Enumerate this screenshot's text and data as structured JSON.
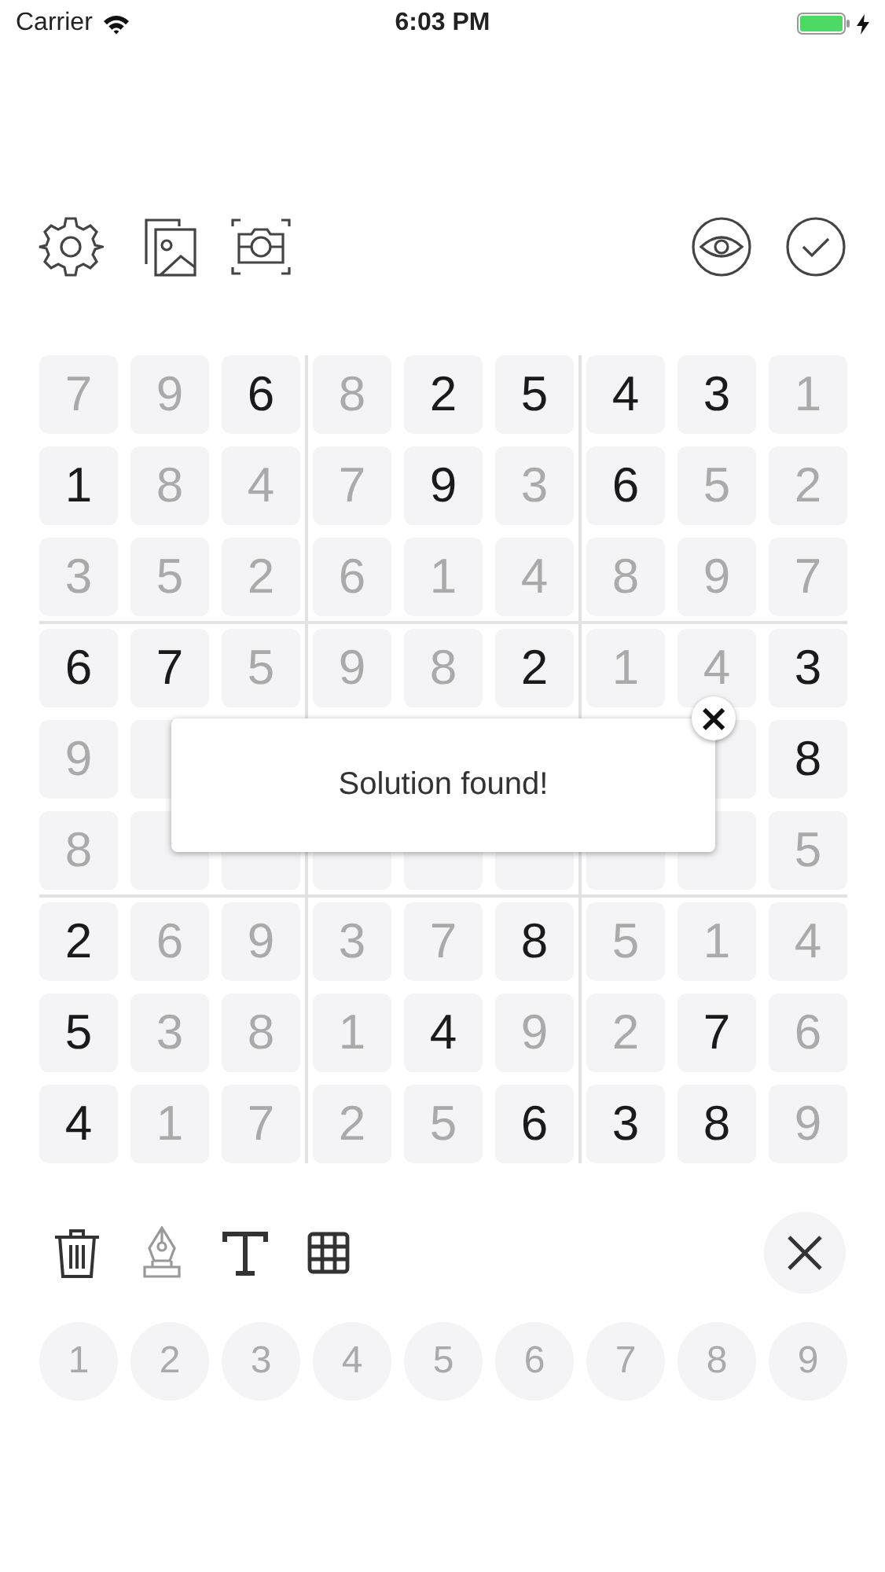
{
  "status_bar": {
    "carrier": "Carrier",
    "time": "6:03 PM",
    "charging": true
  },
  "board": {
    "rows": [
      [
        {
          "value": "7",
          "given": false
        },
        {
          "value": "9",
          "given": false
        },
        {
          "value": "6",
          "given": true
        },
        {
          "value": "8",
          "given": false
        },
        {
          "value": "2",
          "given": true
        },
        {
          "value": "5",
          "given": true
        },
        {
          "value": "4",
          "given": true
        },
        {
          "value": "3",
          "given": true
        },
        {
          "value": "1",
          "given": false
        }
      ],
      [
        {
          "value": "1",
          "given": true
        },
        {
          "value": "8",
          "given": false
        },
        {
          "value": "4",
          "given": false
        },
        {
          "value": "7",
          "given": false
        },
        {
          "value": "9",
          "given": true
        },
        {
          "value": "3",
          "given": false
        },
        {
          "value": "6",
          "given": true
        },
        {
          "value": "5",
          "given": false
        },
        {
          "value": "2",
          "given": false
        }
      ],
      [
        {
          "value": "3",
          "given": false
        },
        {
          "value": "5",
          "given": false
        },
        {
          "value": "2",
          "given": false
        },
        {
          "value": "6",
          "given": false
        },
        {
          "value": "1",
          "given": false
        },
        {
          "value": "4",
          "given": false
        },
        {
          "value": "8",
          "given": false
        },
        {
          "value": "9",
          "given": false
        },
        {
          "value": "7",
          "given": false
        }
      ],
      [
        {
          "value": "6",
          "given": true
        },
        {
          "value": "7",
          "given": true
        },
        {
          "value": "5",
          "given": false
        },
        {
          "value": "9",
          "given": false
        },
        {
          "value": "8",
          "given": false
        },
        {
          "value": "2",
          "given": true
        },
        {
          "value": "1",
          "given": false
        },
        {
          "value": "4",
          "given": false
        },
        {
          "value": "3",
          "given": true
        }
      ],
      [
        {
          "value": "9",
          "given": false
        },
        {},
        {},
        {},
        {},
        {},
        {},
        {},
        {
          "value": "8",
          "given": true
        }
      ],
      [
        {
          "value": "8",
          "given": false
        },
        {},
        {},
        {},
        {},
        {},
        {},
        {},
        {
          "value": "5",
          "given": false
        }
      ],
      [
        {
          "value": "2",
          "given": true
        },
        {
          "value": "6",
          "given": false
        },
        {
          "value": "9",
          "given": false
        },
        {
          "value": "3",
          "given": false
        },
        {
          "value": "7",
          "given": false
        },
        {
          "value": "8",
          "given": true
        },
        {
          "value": "5",
          "given": false
        },
        {
          "value": "1",
          "given": false
        },
        {
          "value": "4",
          "given": false
        }
      ],
      [
        {
          "value": "5",
          "given": true
        },
        {
          "value": "3",
          "given": false
        },
        {
          "value": "8",
          "given": false
        },
        {
          "value": "1",
          "given": false
        },
        {
          "value": "4",
          "given": true
        },
        {
          "value": "9",
          "given": false
        },
        {
          "value": "2",
          "given": false
        },
        {
          "value": "7",
          "given": true
        },
        {
          "value": "6",
          "given": false
        }
      ],
      [
        {
          "value": "4",
          "given": true
        },
        {
          "value": "1",
          "given": false
        },
        {
          "value": "7",
          "given": false
        },
        {
          "value": "2",
          "given": false
        },
        {
          "value": "5",
          "given": false
        },
        {
          "value": "6",
          "given": true
        },
        {
          "value": "3",
          "given": true
        },
        {
          "value": "8",
          "given": true
        },
        {
          "value": "9",
          "given": false
        }
      ]
    ]
  },
  "alert": {
    "message": "Solution found!",
    "close": "×"
  },
  "edit_tools": [
    {
      "kind": "trash",
      "disabled": false
    },
    {
      "kind": "pen",
      "disabled": true
    },
    {
      "kind": "text",
      "disabled": false
    },
    {
      "kind": "grid",
      "disabled": false
    }
  ],
  "number_pad": [
    {
      "label": "1",
      "disabled": true
    },
    {
      "label": "2",
      "disabled": true
    },
    {
      "label": "3",
      "disabled": true
    },
    {
      "label": "4",
      "disabled": true
    },
    {
      "label": "5",
      "disabled": true
    },
    {
      "label": "6",
      "disabled": true
    },
    {
      "label": "7",
      "disabled": true
    },
    {
      "label": "8",
      "disabled": true
    },
    {
      "label": "9",
      "disabled": true
    }
  ]
}
